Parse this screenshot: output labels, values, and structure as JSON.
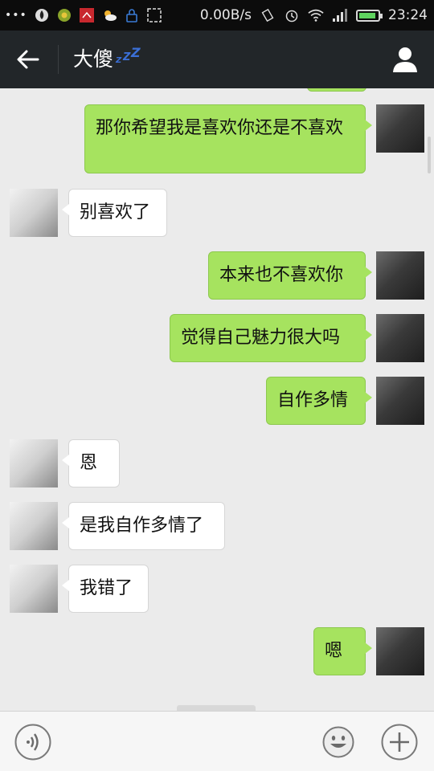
{
  "status_bar": {
    "speed": "0.00B/s",
    "time": "23:24",
    "battery_level": 0.9,
    "icons": [
      "dots-icon",
      "flame-icon",
      "app-icon",
      "email-icon",
      "weather-icon",
      "lock-icon",
      "screenshot-icon",
      "vibrate-icon",
      "alarm-icon",
      "wifi-icon",
      "signal-icon",
      "battery-icon"
    ]
  },
  "nav": {
    "title": "大傻",
    "status_icon": "sleep-zzz-icon",
    "status_text": "Z"
  },
  "messages": [
    {
      "side": "right",
      "text": "那你希望我是喜欢你还是不喜欢"
    },
    {
      "side": "left",
      "text": "别喜欢了"
    },
    {
      "side": "right",
      "text": "本来也不喜欢你"
    },
    {
      "side": "right",
      "text": "觉得自己魅力很大吗"
    },
    {
      "side": "right",
      "text": "自作多情"
    },
    {
      "side": "left",
      "text": "恩"
    },
    {
      "side": "left",
      "text": "是我自作多情了"
    },
    {
      "side": "left",
      "text": "我错了"
    },
    {
      "side": "right",
      "text": "嗯"
    }
  ],
  "bottom_bar": {
    "voice_icon": "voice-icon",
    "emoji_icon": "emoji-icon",
    "plus_icon": "plus-icon"
  },
  "colors": {
    "sent_bubble": "#a6e35f",
    "received_bubble": "#ffffff",
    "nav_background": "#222629",
    "chat_background": "#ebebeb"
  }
}
